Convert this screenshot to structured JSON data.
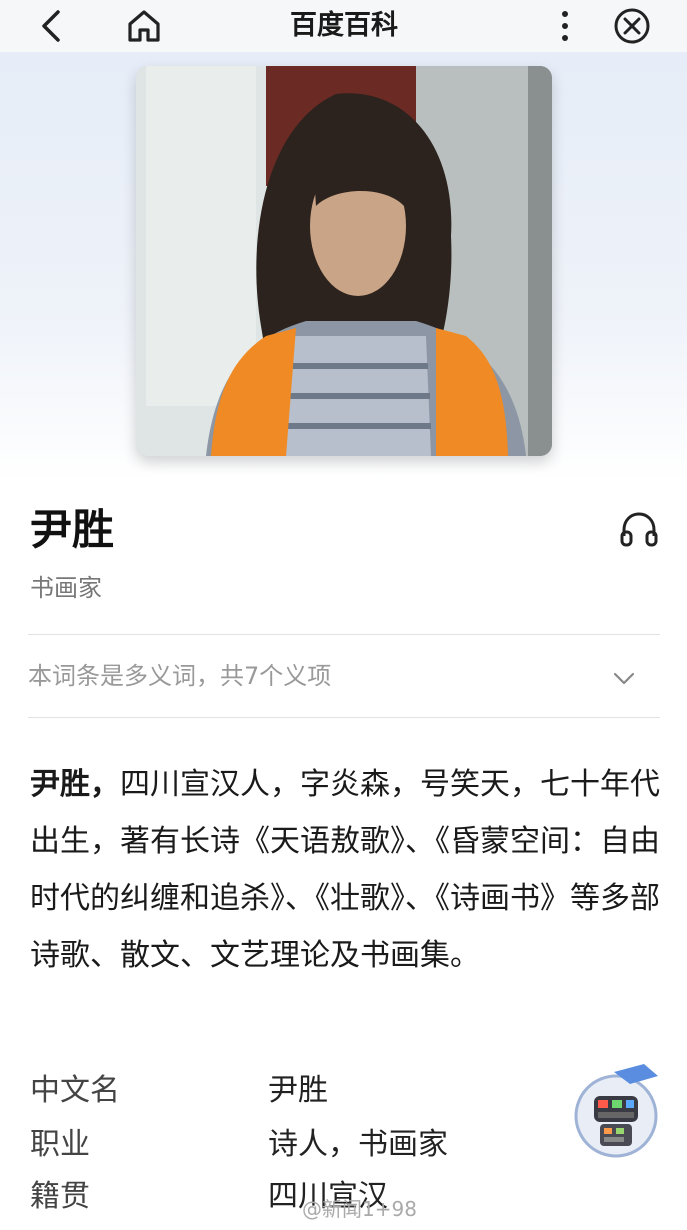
{
  "nav": {
    "title": "百度百科",
    "back_icon": "chevron-left-icon",
    "home_icon": "home-icon",
    "more_icon": "more-vertical-icon",
    "close_icon": "close-circle-icon"
  },
  "entry": {
    "title": "尹胜",
    "subtitle": "书画家",
    "audio_icon": "headphones-icon",
    "polysemy_text": "本词条是多义词，共7个义项",
    "polysemy_icon": "chevron-down-icon"
  },
  "summary": {
    "name": "尹胜，",
    "text": "四川宣汉人，字炎森，号笑天，七十年代出生，著有长诗《天语敖歌》、《昏蒙空间：自由时代的纠缠和追杀》、《壮歌》、《诗画书》等多部诗歌、散文、文艺理论及书画集。"
  },
  "info": [
    {
      "key": "中文名",
      "value": "尹胜"
    },
    {
      "key": "职业",
      "value": "诗人，书画家"
    },
    {
      "key": "籍贯",
      "value": "四川宣汉"
    }
  ],
  "watermark": "@新闻1+98",
  "colors": {
    "topbar_bg": "#f6f7f9",
    "hero_bg": "#e6edf8",
    "vest_orange": "#f08a24"
  }
}
